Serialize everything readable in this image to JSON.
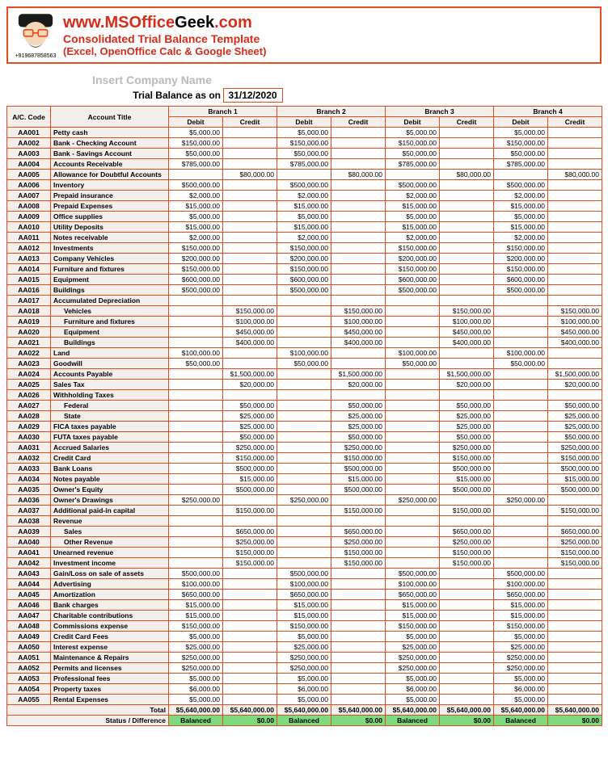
{
  "header": {
    "phone": "+919687858563",
    "url_parts": [
      "www.",
      "MSOffice",
      "Geek",
      ".com"
    ],
    "subtitle": "Consolidated Trial Balance Template",
    "subtitle2": "(Excel, OpenOffice Calc & Google Sheet)"
  },
  "company_placeholder": "Insert Company Name",
  "trial_label": "Trial Balance as on",
  "trial_date": "31/12/2020",
  "col_headers": {
    "code": "A/C. Code",
    "title": "Account Title",
    "branches": [
      "Branch 1",
      "Branch 2",
      "Branch 3",
      "Branch 4"
    ],
    "debit": "Debit",
    "credit": "Credit"
  },
  "rows": [
    {
      "code": "AA001",
      "title": "Petty cash",
      "d": "$5,000.00",
      "c": ""
    },
    {
      "code": "AA002",
      "title": "Bank - Checking Account",
      "d": "$150,000.00",
      "c": ""
    },
    {
      "code": "AA003",
      "title": "Bank - Savings Account",
      "d": "$50,000.00",
      "c": ""
    },
    {
      "code": "AA004",
      "title": "Accounts Receivable",
      "d": "$785,000.00",
      "c": ""
    },
    {
      "code": "AA005",
      "title": "Allowance for Doubtful Accounts",
      "d": "",
      "c": "$80,000.00"
    },
    {
      "code": "AA006",
      "title": "Inventory",
      "d": "$500,000.00",
      "c": ""
    },
    {
      "code": "AA007",
      "title": "Prepaid insurance",
      "d": "$2,000.00",
      "c": ""
    },
    {
      "code": "AA008",
      "title": "Prepaid Expenses",
      "d": "$15,000.00",
      "c": ""
    },
    {
      "code": "AA009",
      "title": "Office supplies",
      "d": "$5,000.00",
      "c": ""
    },
    {
      "code": "AA010",
      "title": "Utility Deposits",
      "d": "$15,000.00",
      "c": ""
    },
    {
      "code": "AA011",
      "title": "Notes receivable",
      "d": "$2,000.00",
      "c": ""
    },
    {
      "code": "AA012",
      "title": "Investments",
      "d": "$150,000.00",
      "c": ""
    },
    {
      "code": "AA013",
      "title": "Company Vehicles",
      "d": "$200,000.00",
      "c": ""
    },
    {
      "code": "AA014",
      "title": "Furniture and fixtures",
      "d": "$150,000.00",
      "c": ""
    },
    {
      "code": "AA015",
      "title": "Equipment",
      "d": "$600,000.00",
      "c": ""
    },
    {
      "code": "AA016",
      "title": "Buildings",
      "d": "$500,000.00",
      "c": ""
    },
    {
      "code": "AA017",
      "title": "Accumulated Depreciation",
      "d": "",
      "c": ""
    },
    {
      "code": "AA018",
      "title": "Vehicles",
      "indent": true,
      "d": "",
      "c": "$150,000.00"
    },
    {
      "code": "AA019",
      "title": "Furniture and fixtures",
      "indent": true,
      "d": "",
      "c": "$100,000.00"
    },
    {
      "code": "AA020",
      "title": "Equipment",
      "indent": true,
      "d": "",
      "c": "$450,000.00"
    },
    {
      "code": "AA021",
      "title": "Buildings",
      "indent": true,
      "d": "",
      "c": "$400,000.00"
    },
    {
      "code": "AA022",
      "title": "Land",
      "d": "$100,000.00",
      "c": ""
    },
    {
      "code": "AA023",
      "title": "Goodwill",
      "d": "$50,000.00",
      "c": ""
    },
    {
      "code": "AA024",
      "title": "Accounts Payable",
      "d": "",
      "c": "$1,500,000.00"
    },
    {
      "code": "AA025",
      "title": "Sales Tax",
      "d": "",
      "c": "$20,000.00"
    },
    {
      "code": "AA026",
      "title": "Withholding Taxes",
      "d": "",
      "c": ""
    },
    {
      "code": "AA027",
      "title": "Federal",
      "indent": true,
      "d": "",
      "c": "$50,000.00"
    },
    {
      "code": "AA028",
      "title": "State",
      "indent": true,
      "d": "",
      "c": "$25,000.00"
    },
    {
      "code": "AA029",
      "title": "FICA taxes payable",
      "d": "",
      "c": "$25,000.00"
    },
    {
      "code": "AA030",
      "title": "FUTA taxes payable",
      "d": "",
      "c": "$50,000.00"
    },
    {
      "code": "AA031",
      "title": "Accrued Salaries",
      "d": "",
      "c": "$250,000.00"
    },
    {
      "code": "AA032",
      "title": "Credit Card",
      "d": "",
      "c": "$150,000.00"
    },
    {
      "code": "AA033",
      "title": "Bank Loans",
      "d": "",
      "c": "$500,000.00"
    },
    {
      "code": "AA034",
      "title": "Notes payable",
      "d": "",
      "c": "$15,000.00"
    },
    {
      "code": "AA035",
      "title": "Owner's Equity",
      "d": "",
      "c": "$500,000.00"
    },
    {
      "code": "AA036",
      "title": "Owner's Drawings",
      "d": "$250,000.00",
      "c": ""
    },
    {
      "code": "AA037",
      "title": "Additional paid-in capital",
      "d": "",
      "c": "$150,000.00"
    },
    {
      "code": "AA038",
      "title": "Revenue",
      "d": "",
      "c": ""
    },
    {
      "code": "AA039",
      "title": "Sales",
      "indent": true,
      "d": "",
      "c": "$650,000.00"
    },
    {
      "code": "AA040",
      "title": "Other Revenue",
      "indent": true,
      "d": "",
      "c": "$250,000.00"
    },
    {
      "code": "AA041",
      "title": "Unearned revenue",
      "d": "",
      "c": "$150,000.00"
    },
    {
      "code": "AA042",
      "title": "Investment income",
      "d": "",
      "c": "$150,000.00"
    },
    {
      "code": "AA043",
      "title": "Gain/Loss on sale of assets",
      "d": "$500,000.00",
      "c": ""
    },
    {
      "code": "AA044",
      "title": "Advertising",
      "d": "$100,000.00",
      "c": ""
    },
    {
      "code": "AA045",
      "title": "Amortization",
      "d": "$650,000.00",
      "c": ""
    },
    {
      "code": "AA046",
      "title": "Bank charges",
      "d": "$15,000.00",
      "c": ""
    },
    {
      "code": "AA047",
      "title": "Charitable contributions",
      "d": "$15,000.00",
      "c": ""
    },
    {
      "code": "AA048",
      "title": "Commissions expense",
      "d": "$150,000.00",
      "c": ""
    },
    {
      "code": "AA049",
      "title": "Credit Card Fees",
      "d": "$5,000.00",
      "c": ""
    },
    {
      "code": "AA050",
      "title": "Interest expense",
      "d": "$25,000.00",
      "c": ""
    },
    {
      "code": "AA051",
      "title": "Maintenance & Repairs",
      "d": "$250,000.00",
      "c": ""
    },
    {
      "code": "AA052",
      "title": "Permits and licenses",
      "d": "$250,000.00",
      "c": ""
    },
    {
      "code": "AA053",
      "title": "Professional fees",
      "d": "$5,000.00",
      "c": ""
    },
    {
      "code": "AA054",
      "title": "Property taxes",
      "d": "$6,000.00",
      "c": ""
    },
    {
      "code": "AA055",
      "title": "Rental Expenses",
      "d": "$5,000.00",
      "c": ""
    }
  ],
  "totals": {
    "label": "Total",
    "debit": "$5,640,000.00",
    "credit": "$5,640,000.00"
  },
  "status": {
    "label": "Status / Difference",
    "balanced": "Balanced",
    "diff": "$0.00"
  }
}
